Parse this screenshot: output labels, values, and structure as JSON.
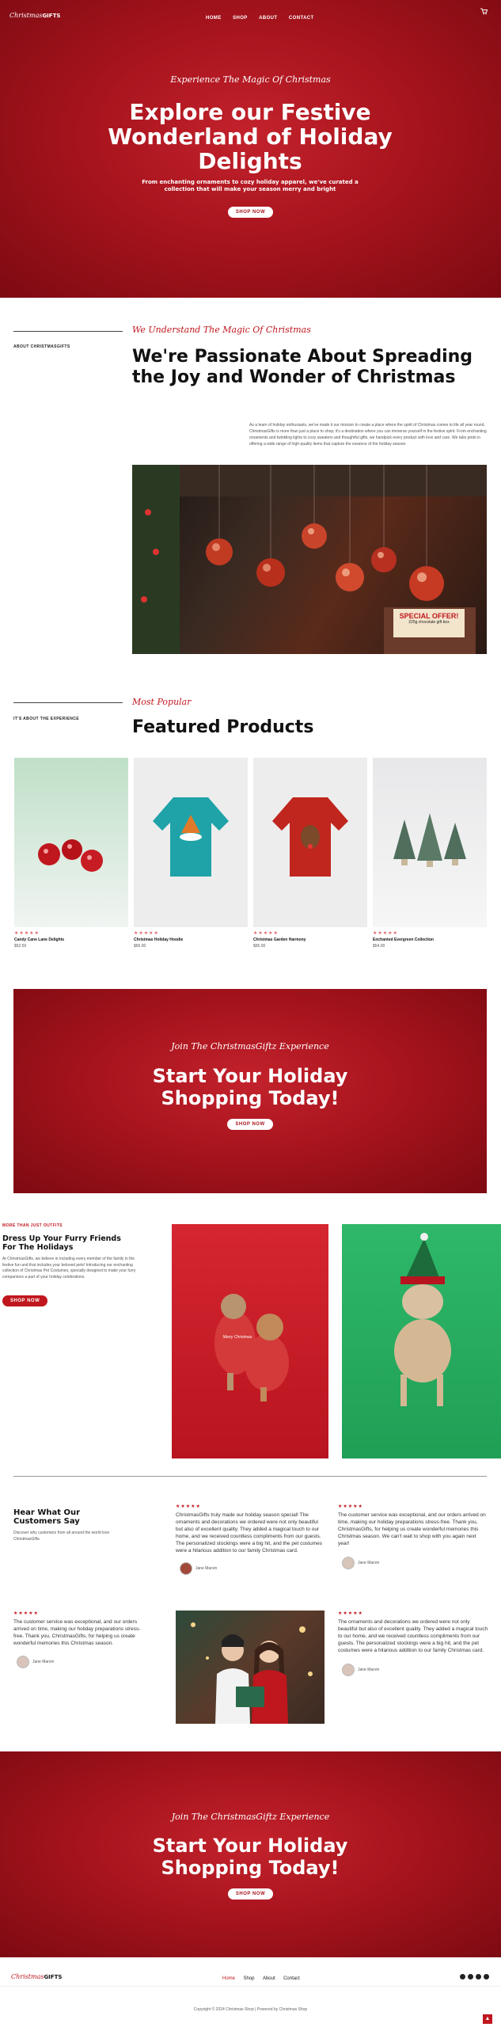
{
  "header": {
    "logo_script": "Christmas",
    "logo_bold": "GIFTS",
    "nav": [
      "HOME",
      "SHOP",
      "ABOUT",
      "CONTACT"
    ]
  },
  "hero": {
    "tagline": "Experience The Magic Of Christmas",
    "title": "Explore our Festive Wonderland of Holiday Delights",
    "subtitle": "From enchanting ornaments to cozy holiday apparel, we've curated a collection that will make your season merry and bright",
    "button": "SHOP NOW"
  },
  "about": {
    "side_label": "ABOUT CHRISTMASGIFTS",
    "tagline": "We Understand The Magic Of Christmas",
    "title": "We're Passionate About Spreading the Joy and Wonder of Christmas",
    "body": "As a team of holiday enthusiasts, we've made it our mission to create a place where the spirit of Christmas comes to life all year round. ChristmasGifts is more than just a place to shop; it's a destination where you can immerse yourself in the festive spirit. From enchanting ornaments and twinkling lights to cozy sweaters and thoughtful gifts, we handpick every product with love and care. We take pride in offering a wide range of high-quality items that capture the essence of the holiday season.",
    "image_sign": "SPECIAL OFFER!",
    "image_sign_sub": "225g chocolate gift box"
  },
  "featured": {
    "side_label": "IT'S ABOUT THE EXPERIENCE",
    "tagline": "Most Popular",
    "title": "Featured Products",
    "products": [
      {
        "name": "Candy Cane Lane Delights",
        "price": "$52.50",
        "stars": "★★★★★"
      },
      {
        "name": "Christmas Holiday Hoodie",
        "price": "$65.00",
        "stars": "★★★★★"
      },
      {
        "name": "Christmas Garden Harmony",
        "price": "$65.00",
        "stars": "★★★★★"
      },
      {
        "name": "Enchanted Evergreen Collection",
        "price": "$54.00",
        "stars": "★★★★★"
      }
    ]
  },
  "cta1": {
    "tagline": "Join The ChristmasGiftz Experience",
    "title": "Start Your Holiday Shopping Today!",
    "button": "SHOP NOW"
  },
  "pets": {
    "label": "MORE THAN JUST OUTFITS",
    "title": "Dress Up Your Furry Friends For The Holidays",
    "body": "At ChristmasGifts, we believe in including every member of the family in the festive fun and that includes your beloved pets! Introducing our enchanting collection of Christmas Pet Costumes, specially designed to make your furry companions a part of your holiday celebrations.",
    "button": "SHOP NOW",
    "sweater_text": "Merry Christmas"
  },
  "testimonials": {
    "title": "Hear What Our Customers Say",
    "subtitle": "Discover why customers from all around the world love ChristmasGifts.",
    "items": [
      {
        "stars": "★★★★★",
        "text": "ChristmasGifts truly made our holiday season special! The ornaments and decorations we ordered were not only beautiful but also of excellent quality. They added a magical touch to our home, and we received countless compliments from our guests. The personalized stockings were a big hit, and the pet costumes were a hilarious addition to our family Christmas card.",
        "author": "Jane Marvin"
      },
      {
        "stars": "★★★★★",
        "text": "The customer service was exceptional, and our orders arrived on time, making our holiday preparations stress-free. Thank you, ChristmasGifts, for helping us create wonderful memories this Christmas season. We can't wait to shop with you again next year!",
        "author": "Jane Marvin"
      },
      {
        "stars": "★★★★★",
        "text": "The customer service was exceptional, and our orders arrived on time, making our holiday preparations stress-free. Thank you, ChristmasGifts, for helping us create wonderful memories this Christmas season.",
        "author": "Jane Marvin"
      },
      {
        "stars": "★★★★★",
        "text": "The ornaments and decorations we ordered were not only beautiful but also of excellent quality. They added a magical touch to our home, and we received countless compliments from our guests. The personalized stockings were a big hit, and the pet costumes were a hilarious addition to our family Christmas card.",
        "author": "Jane Marvin"
      }
    ]
  },
  "cta2": {
    "tagline": "Join The ChristmasGiftz Experience",
    "title": "Start Your Holiday Shopping Today!",
    "button": "SHOP NOW"
  },
  "footer": {
    "logo_script": "Christmas",
    "logo_bold": "GIFTS",
    "nav": [
      "Home",
      "Shop",
      "About",
      "Contact"
    ],
    "social_icons": [
      "facebook-icon",
      "instagram-icon",
      "twitter-icon",
      "youtube-icon"
    ],
    "copyright": "Copyright © 2024 Christmas Shop | Powered by Christmas Shop"
  },
  "colors": {
    "brand_red": "#c0161d",
    "dark_red": "#7d0a12"
  }
}
